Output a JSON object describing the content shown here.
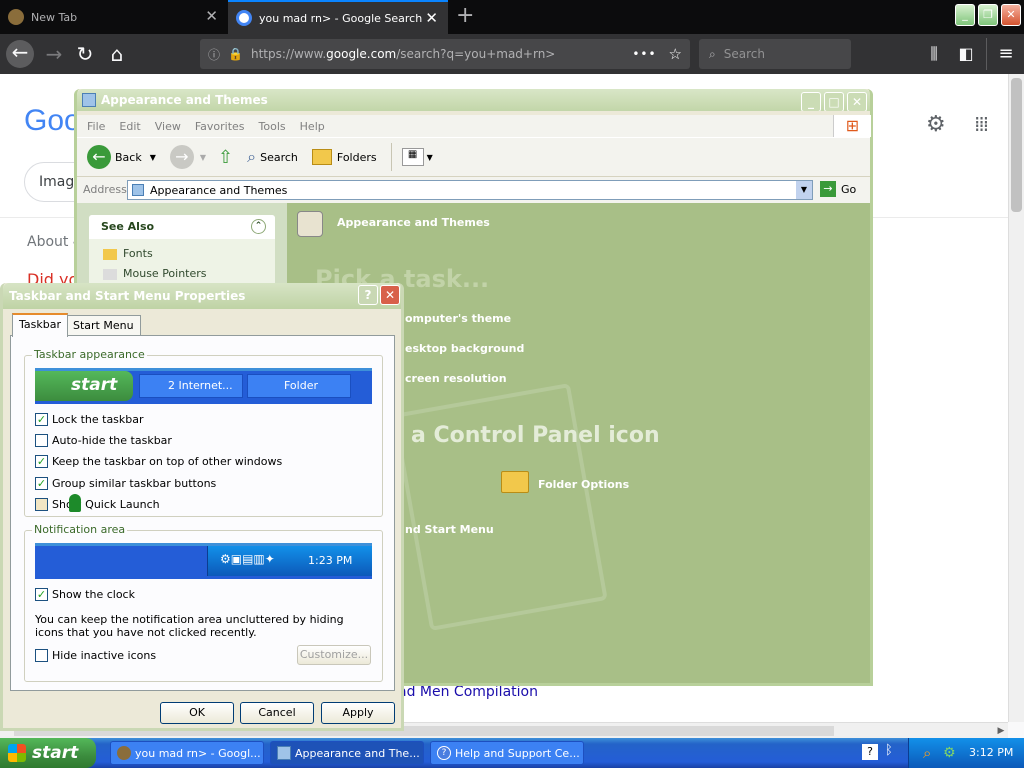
{
  "browser": {
    "tabs": [
      {
        "label": "New Tab",
        "active": false
      },
      {
        "label": "you mad rn> - Google Search",
        "active": true
      }
    ],
    "url_prefix": "https://www.",
    "url_domain": "google.com",
    "url_path": "/search?q=you+mad+rn>",
    "search_placeholder": "Search"
  },
  "google": {
    "logo_partial": "Goo",
    "images_tab": "Image",
    "about_text": "About 4",
    "did_you": "Did yo",
    "result_link": "ad Men Compilation"
  },
  "explorer": {
    "title": "Appearance and Themes",
    "menu": [
      "File",
      "Edit",
      "View",
      "Favorites",
      "Tools",
      "Help"
    ],
    "toolbar": {
      "back": "Back",
      "search": "Search",
      "folders": "Folders"
    },
    "address_label": "Address",
    "address_value": "Appearance and Themes",
    "go_label": "Go",
    "see_also": {
      "title": "See Also",
      "items": [
        "Fonts",
        "Mouse Pointers"
      ]
    },
    "panel_heading": "Appearance and Themes",
    "pick_task": "Pick a task...",
    "tasks": [
      "omputer's theme",
      "esktop background",
      "creen resolution"
    ],
    "control_panel_icon": "a Control Panel icon",
    "icons": [
      "Folder Options",
      "nd Start Menu"
    ]
  },
  "dialog": {
    "title": "Taskbar and Start Menu Properties",
    "tabs": [
      "Taskbar",
      "Start Menu"
    ],
    "taskbar_appearance": "Taskbar appearance",
    "preview_start": "start",
    "preview_task1": "2 Internet...",
    "preview_task2": "Folder",
    "options": [
      {
        "label": "Lock the taskbar",
        "checked": true
      },
      {
        "label": "Auto-hide the taskbar",
        "checked": false
      },
      {
        "label": "Keep the taskbar on top of other windows",
        "checked": true
      },
      {
        "label": "Group similar taskbar buttons",
        "checked": true
      },
      {
        "label": "Show Quick Launch",
        "checked": false
      }
    ],
    "notification_area": "Notification area",
    "preview_clock": "1:23 PM",
    "show_clock": {
      "label": "Show the clock",
      "checked": true
    },
    "hint": "You can keep the notification area uncluttered by hiding icons that you have not clicked recently.",
    "hide_inactive": {
      "label": "Hide inactive icons",
      "checked": false
    },
    "customize": "Customize...",
    "ok": "OK",
    "cancel": "Cancel",
    "apply": "Apply"
  },
  "taskbar": {
    "start": "start",
    "tasks": [
      "you mad rn> - Googl...",
      "Appearance and The...",
      "Help and Support Ce..."
    ],
    "clock": "3:12 PM"
  },
  "colors": {
    "xp_blue": "#245dd7",
    "xp_green": "#3c8c3e",
    "explorer_body": "#a8bf87"
  }
}
